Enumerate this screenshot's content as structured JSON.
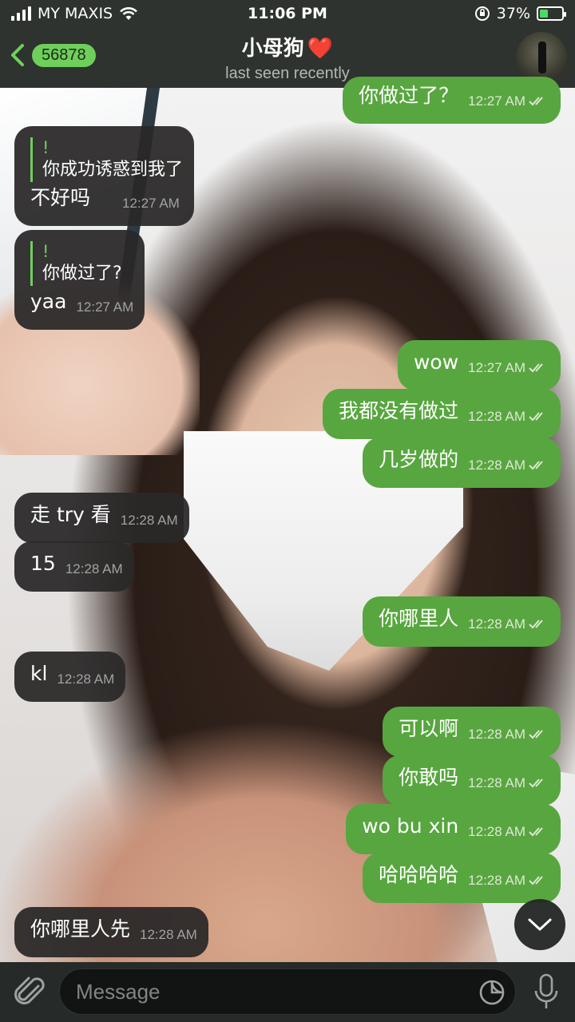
{
  "status_bar": {
    "carrier": "MY MAXIS",
    "time": "11:06 PM",
    "battery_percent": "37%",
    "battery_level": 0.37
  },
  "header": {
    "back_count": "56878",
    "title": "小母狗",
    "title_emoji": "❤️",
    "subtitle": "last seen recently"
  },
  "messages": [
    {
      "dir": "out",
      "text": "你做过了？",
      "time": "12:27 AM"
    },
    {
      "dir": "in",
      "reply_name": "!",
      "reply_text": "你成功诱惑到我了",
      "text": "不好吗",
      "time": "12:27 AM"
    },
    {
      "dir": "in",
      "reply_name": "!",
      "reply_text": "你做过了?",
      "text": "yaa",
      "time": "12:27 AM"
    },
    {
      "dir": "out",
      "text": "wow",
      "time": "12:27 AM"
    },
    {
      "dir": "out",
      "text": "我都没有做过",
      "time": "12:28 AM"
    },
    {
      "dir": "out",
      "text": "几岁做的",
      "time": "12:28 AM"
    },
    {
      "dir": "in",
      "text": "走 try 看",
      "time": "12:28 AM"
    },
    {
      "dir": "in",
      "text": "15",
      "time": "12:28 AM"
    },
    {
      "dir": "out",
      "text": "你哪里人",
      "time": "12:28 AM"
    },
    {
      "dir": "in",
      "text": "kl",
      "time": "12:28 AM"
    },
    {
      "dir": "out",
      "text": "可以啊",
      "time": "12:28 AM"
    },
    {
      "dir": "out",
      "text": "你敢吗",
      "time": "12:28 AM"
    },
    {
      "dir": "out",
      "text": "wo bu xin",
      "time": "12:28 AM"
    },
    {
      "dir": "out",
      "text": "哈哈哈哈",
      "time": "12:28 AM"
    },
    {
      "dir": "in",
      "text": "你哪里人先",
      "time": "12:28 AM"
    }
  ],
  "input": {
    "placeholder": "Message"
  },
  "colors": {
    "accent": "#6fcf5b",
    "outgoing_bubble": "#58a63f",
    "incoming_bubble": "#2a2828",
    "header_bg": "#262c28"
  },
  "icons": {
    "attach": "paperclip-icon",
    "sticker": "sticker-icon",
    "mic": "microphone-icon",
    "scroll_down": "chevron-down-icon",
    "back": "chevron-left-icon"
  }
}
